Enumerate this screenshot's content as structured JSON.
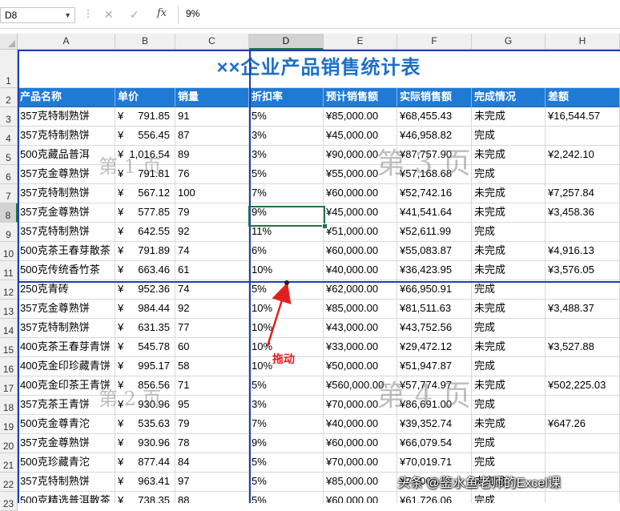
{
  "formula_bar": {
    "name_box": "D8",
    "formula": "9%"
  },
  "columns": [
    "A",
    "B",
    "C",
    "D",
    "E",
    "F",
    "G",
    "H"
  ],
  "selected_column": "D",
  "selected_row": "8",
  "rows": [
    "1",
    "2",
    "3",
    "4",
    "5",
    "6",
    "7",
    "8",
    "9",
    "10",
    "11",
    "12",
    "13",
    "14",
    "15",
    "16",
    "17",
    "18",
    "19",
    "20",
    "21",
    "22",
    "23"
  ],
  "sheet": {
    "title": "××企业产品销售统计表",
    "headers": [
      "产品名称",
      "单价",
      "销量",
      "折扣率",
      "预计销售额",
      "实际销售额",
      "完成情况",
      "差额"
    ],
    "currency_symbol": "¥",
    "data": [
      [
        "357克特制熟饼",
        "791.85",
        "91",
        "5%",
        "¥85,000.00",
        "¥68,455.43",
        "未完成",
        "¥16,544.57"
      ],
      [
        "357克特制熟饼",
        "556.45",
        "87",
        "3%",
        "¥45,000.00",
        "¥46,958.82",
        "完成",
        ""
      ],
      [
        "500克藏品普洱",
        "1,016.54",
        "89",
        "3%",
        "¥90,000.00",
        "¥87,757.90",
        "未完成",
        "¥2,242.10"
      ],
      [
        "357克金尊熟饼",
        "791.81",
        "76",
        "5%",
        "¥55,000.00",
        "¥57,168.68",
        "完成",
        ""
      ],
      [
        "357克特制熟饼",
        "567.12",
        "100",
        "7%",
        "¥60,000.00",
        "¥52,742.16",
        "未完成",
        "¥7,257.84"
      ],
      [
        "357克金尊熟饼",
        "577.85",
        "79",
        "9%",
        "¥45,000.00",
        "¥41,541.64",
        "未完成",
        "¥3,458.36"
      ],
      [
        "357克特制熟饼",
        "642.55",
        "92",
        "11%",
        "¥51,000.00",
        "¥52,611.99",
        "完成",
        ""
      ],
      [
        "500克茶王春芽散茶",
        "791.89",
        "74",
        "6%",
        "¥60,000.00",
        "¥55,083.87",
        "未完成",
        "¥4,916.13"
      ],
      [
        "500克传统香竹茶",
        "663.46",
        "61",
        "10%",
        "¥40,000.00",
        "¥36,423.95",
        "未完成",
        "¥3,576.05"
      ],
      [
        "250克青砖",
        "952.36",
        "74",
        "5%",
        "¥62,000.00",
        "¥66,950.91",
        "完成",
        ""
      ],
      [
        "357克金尊熟饼",
        "984.44",
        "92",
        "10%",
        "¥85,000.00",
        "¥81,511.63",
        "未完成",
        "¥3,488.37"
      ],
      [
        "357克特制熟饼",
        "631.35",
        "77",
        "10%",
        "¥43,000.00",
        "¥43,752.56",
        "完成",
        ""
      ],
      [
        "400克茶王春芽青饼",
        "545.78",
        "60",
        "10%",
        "¥33,000.00",
        "¥29,472.12",
        "未完成",
        "¥3,527.88"
      ],
      [
        "400克金印珍藏青饼",
        "995.17",
        "58",
        "10%",
        "¥50,000.00",
        "¥51,947.87",
        "完成",
        ""
      ],
      [
        "400克金印茶王青饼",
        "856.56",
        "71",
        "5%",
        "¥560,000.00",
        "¥57,774.97",
        "未完成",
        "¥502,225.03"
      ],
      [
        "357克茶王青饼",
        "930.96",
        "95",
        "3%",
        "¥70,000.00",
        "¥86,691.00",
        "完成",
        ""
      ],
      [
        "500克金尊青沱",
        "535.63",
        "79",
        "7%",
        "¥40,000.00",
        "¥39,352.74",
        "未完成",
        "¥647.26"
      ],
      [
        "357克金尊熟饼",
        "930.96",
        "78",
        "9%",
        "¥60,000.00",
        "¥66,079.54",
        "完成",
        ""
      ],
      [
        "500克珍藏青沱",
        "877.44",
        "84",
        "5%",
        "¥70,000.00",
        "¥70,019.71",
        "完成",
        ""
      ],
      [
        "357克特制熟饼",
        "963.41",
        "97",
        "5%",
        "¥85,000.00",
        "¥71,003.37",
        "未完成",
        ""
      ],
      [
        "500克精选普洱散茶",
        "738.35",
        "88",
        "5%",
        "¥60,000.00",
        "¥61,726.06",
        "完成",
        ""
      ]
    ]
  },
  "watermarks": [
    "第 1 页",
    "第 3 页",
    "第 2 页",
    "第 4 页"
  ],
  "annotation": "拖动",
  "brand": "头条 @鉴水鱼老师的Excel课",
  "colors": {
    "header_fill": "#1f7ad6",
    "title_text": "#1f6fc6",
    "page_break": "#1f3fb0",
    "annotation": "#e02020",
    "selection": "#217346"
  }
}
